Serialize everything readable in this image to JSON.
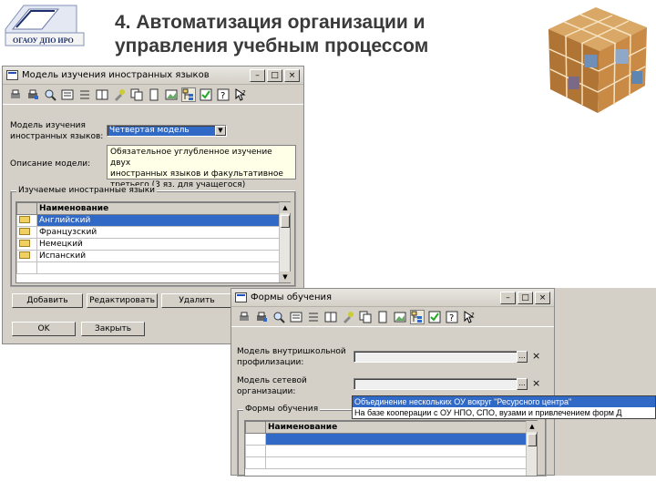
{
  "slide": {
    "logo_text": "ОГАОУ ДПО ИРО",
    "title_line1": "4. Автоматизация организации и",
    "title_line2": "управления учебным процессом"
  },
  "window1": {
    "title": "Модель изучения иностранных языков",
    "study_model_label_1": "Модель изучения",
    "study_model_label_2": "иностранных языков:",
    "study_model_value": "Четвертая модель",
    "description_label": "Описание модели:",
    "description_lines": [
      "Обязательное углубленное изучение двух",
      "иностранных языков и факультативное",
      "третьего (3 яз. для учащегося)"
    ],
    "languages_group_title": "Изучаемые иностранные языки",
    "grid_header": "Наименование",
    "languages": [
      "Английский",
      "Французский",
      "Немецкий",
      "Испанский"
    ],
    "add_button": "Добавить",
    "edit_button": "Редактировать",
    "delete_button": "Удалить",
    "ok_button": "OK",
    "close_button": "Закрыть"
  },
  "window2": {
    "title": "Формы обучения",
    "intra_profile_label_1": "Модель внутришкольной",
    "intra_profile_label_2": "профилизации:",
    "network_label_1": "Модель сетевой",
    "network_label_2": "организации:",
    "forms_group_title": "Формы обучения",
    "grid_header": "Наименование",
    "dropdown_options": [
      "Объединение нескольких ОУ вокруг \"Ресурсного центра\"",
      "На базе кооперации с ОУ НПО, СПО, вузами и привлечением форм Д"
    ]
  },
  "colors": {
    "selection": "#3169c6",
    "window_face": "#d4d0c8",
    "memo_bg": "#ffffe8"
  }
}
